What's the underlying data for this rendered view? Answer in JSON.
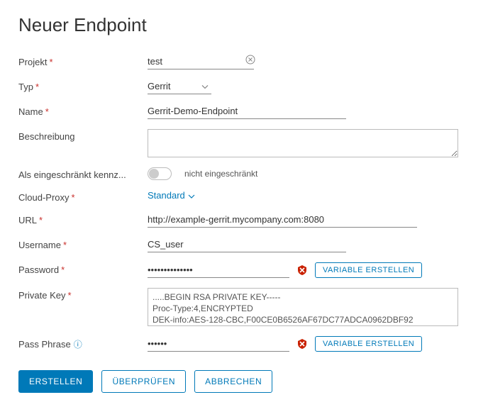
{
  "page_title": "Neuer Endpoint",
  "labels": {
    "project": "Projekt",
    "type": "Typ",
    "name": "Name",
    "description": "Beschreibung",
    "restricted": "Als eingeschränkt kennz...",
    "cloud_proxy": "Cloud-Proxy",
    "url": "URL",
    "username": "Username",
    "password": "Password",
    "private_key": "Private Key",
    "pass_phrase": "Pass Phrase"
  },
  "values": {
    "project": "test",
    "type": "Gerrit",
    "name": "Gerrit-Demo-Endpoint",
    "description": "",
    "restricted_state": "nicht eingeschränkt",
    "cloud_proxy": "Standard",
    "url": "http://example-gerrit.mycompany.com:8080",
    "username": "CS_user",
    "password": "••••••••••••••",
    "private_key": ".....BEGIN RSA PRIVATE KEY-----\nProc-Type:4,ENCRYPTED\nDEK-info:AES-128-CBC,F00CE0B6526AF67DC77ADCA0962DBF92",
    "pass_phrase": "••••••"
  },
  "buttons": {
    "create_variable": "VARIABLE ERSTELLEN",
    "create": "ERSTELLEN",
    "validate": "ÜBERPRÜFEN",
    "cancel": "ABBRECHEN"
  }
}
